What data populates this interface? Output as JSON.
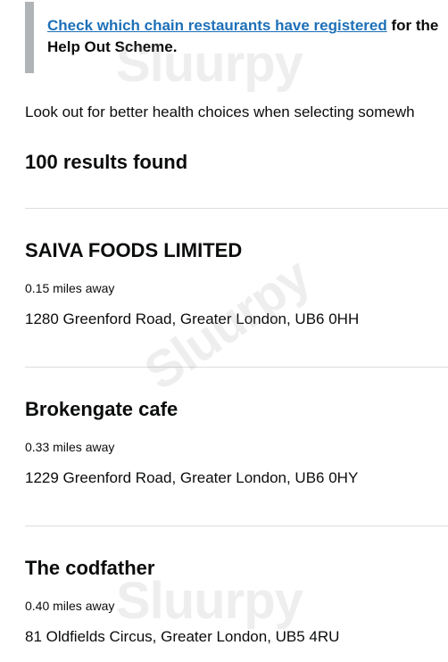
{
  "inset": {
    "link_text": "Check which chain restaurants have registered",
    "line1_rest": " for the",
    "line2": "Help Out Scheme."
  },
  "intro_text": "Look out for better health choices when selecting somewh",
  "results_count": "100 results found",
  "results": [
    {
      "name": "SAIVA FOODS LIMITED",
      "distance": "0.15 miles away",
      "address": "1280 Greenford Road, Greater London, UB6 0HH"
    },
    {
      "name": "Brokengate cafe",
      "distance": "0.33 miles away",
      "address": "1229 Greenford Road, Greater London, UB6 0HY"
    },
    {
      "name": "The codfather",
      "distance": "0.40 miles away",
      "address": "81 Oldfields Circus, Greater London, UB5 4RU"
    }
  ],
  "watermark": "Sluurpy"
}
